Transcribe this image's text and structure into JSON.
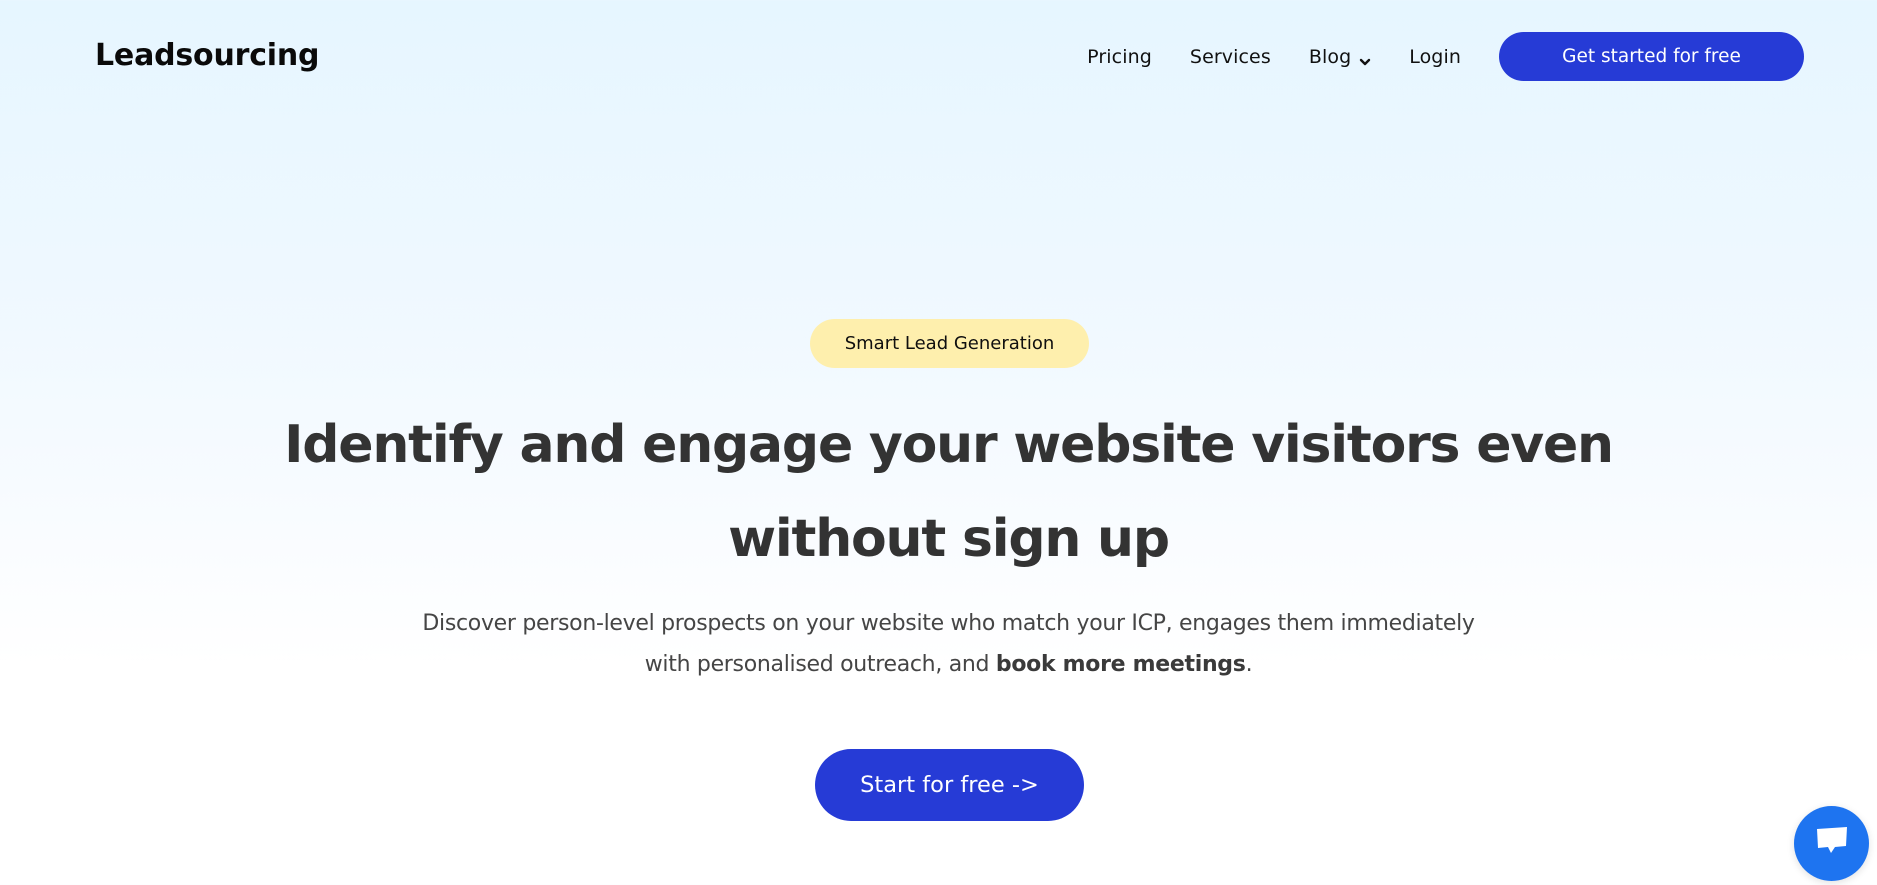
{
  "header": {
    "logo": "Leadsourcing",
    "nav": [
      {
        "label": "Pricing",
        "has_dropdown": false
      },
      {
        "label": "Services",
        "has_dropdown": false
      },
      {
        "label": "Blog",
        "has_dropdown": true,
        "icon": "chevron-down-icon"
      },
      {
        "label": "Login",
        "has_dropdown": false
      }
    ],
    "cta_label": "Get started for free"
  },
  "hero": {
    "badge": "Smart Lead Generation",
    "headline_line1": "Identify and engage your website visitors even",
    "headline_line2": "without sign up",
    "subtext_line1": "Discover person-level prospects on your website who match your ICP, engages them immediately",
    "subtext_line2_prefix": "with personalised outreach, and ",
    "subtext_line2_bold": "book more meetings",
    "subtext_line2_suffix": ".",
    "cta_label": "Start for free ->"
  },
  "chat_widget": {
    "icon": "chat-bubble-icon"
  },
  "colors": {
    "brand_blue": "#263bd6",
    "badge_yellow": "#feefad",
    "chat_blue": "#1e74f0",
    "headline_text": "#333333",
    "background_top": "#e6f6ff",
    "background_bottom": "#ffffff"
  }
}
